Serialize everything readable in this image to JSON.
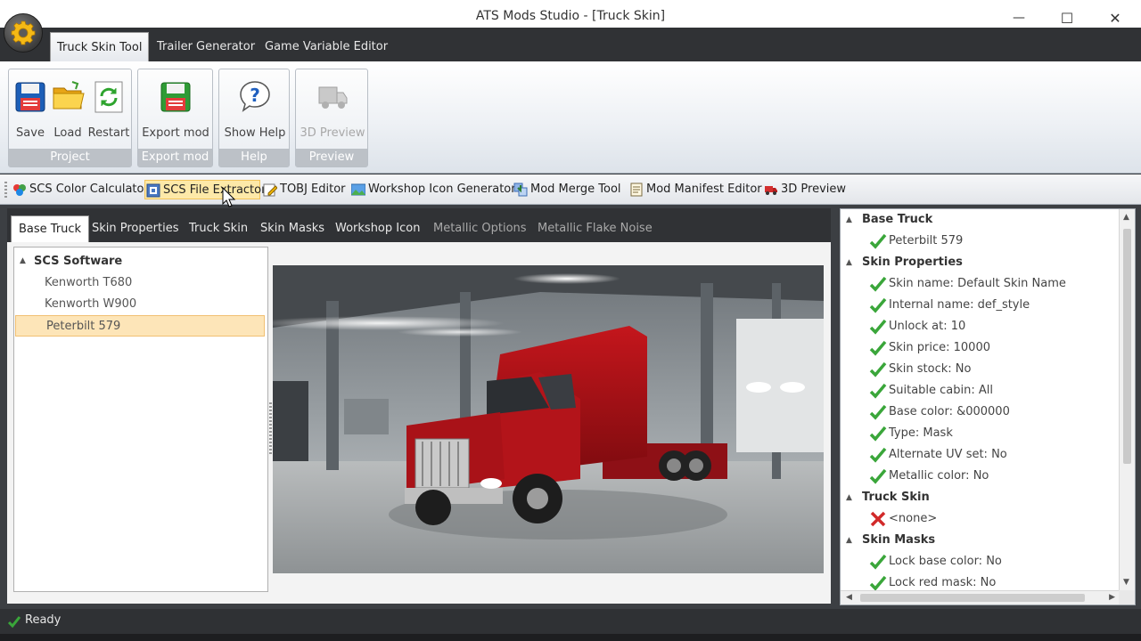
{
  "window": {
    "title": "ATS Mods Studio - [Truck Skin]",
    "minimize": "—",
    "maximize": "☐",
    "close": "✕"
  },
  "ribbon": {
    "tabs": [
      "Truck Skin Tool",
      "Trailer Generator",
      "Game Variable Editor"
    ],
    "groups": {
      "project": {
        "label": "Project",
        "save": "Save",
        "load": "Load",
        "restart": "Restart"
      },
      "export": {
        "label": "Export mod",
        "export": "Export mod"
      },
      "help": {
        "label": "Help",
        "show_help": "Show Help"
      },
      "preview": {
        "label": "Preview",
        "preview_3d": "3D Preview"
      }
    }
  },
  "tools": [
    {
      "label": "SCS Color Calculator",
      "icon": "color-calculator-icon"
    },
    {
      "label": "SCS File Extractor",
      "icon": "file-extractor-icon"
    },
    {
      "label": "TOBJ Editor",
      "icon": "tobj-editor-icon"
    },
    {
      "label": "Workshop Icon Generator",
      "icon": "workshop-icon-icon"
    },
    {
      "label": "Mod Merge Tool",
      "icon": "merge-icon"
    },
    {
      "label": "Mod Manifest Editor",
      "icon": "manifest-icon"
    },
    {
      "label": "3D Preview",
      "icon": "preview-3d-icon"
    }
  ],
  "subtabs": [
    "Base Truck",
    "Skin Properties",
    "Truck Skin",
    "Skin Masks",
    "Workshop Icon",
    "Metallic Options",
    "Metallic Flake Noise"
  ],
  "tree": {
    "root": "SCS Software",
    "items": [
      "Kenworth T680",
      "Kenworth W900",
      "Peterbilt 579"
    ],
    "selected": "Peterbilt 579"
  },
  "properties": {
    "base_truck_label": "Base Truck",
    "base_truck_value": "Peterbilt 579",
    "skin_properties_label": "Skin Properties",
    "skin_properties": [
      "Skin name: Default Skin Name",
      "Internal name: def_style",
      "Unlock at: 10",
      "Skin price: 10000",
      "Skin stock: No",
      "Suitable cabin: All",
      "Base color: &000000",
      "Type: Mask",
      "Alternate UV set: No",
      "Metallic color: No"
    ],
    "truck_skin_label": "Truck Skin",
    "truck_skin_value": "<none>",
    "skin_masks_label": "Skin Masks",
    "skin_masks": [
      "Lock base color: No",
      "Lock red mask: No"
    ]
  },
  "status": {
    "text": "Ready"
  },
  "colors": {
    "ok_check": "#3aa63a",
    "error_x": "#d12a2a",
    "selection": "#fde5b8",
    "dark_chrome": "#303235"
  }
}
